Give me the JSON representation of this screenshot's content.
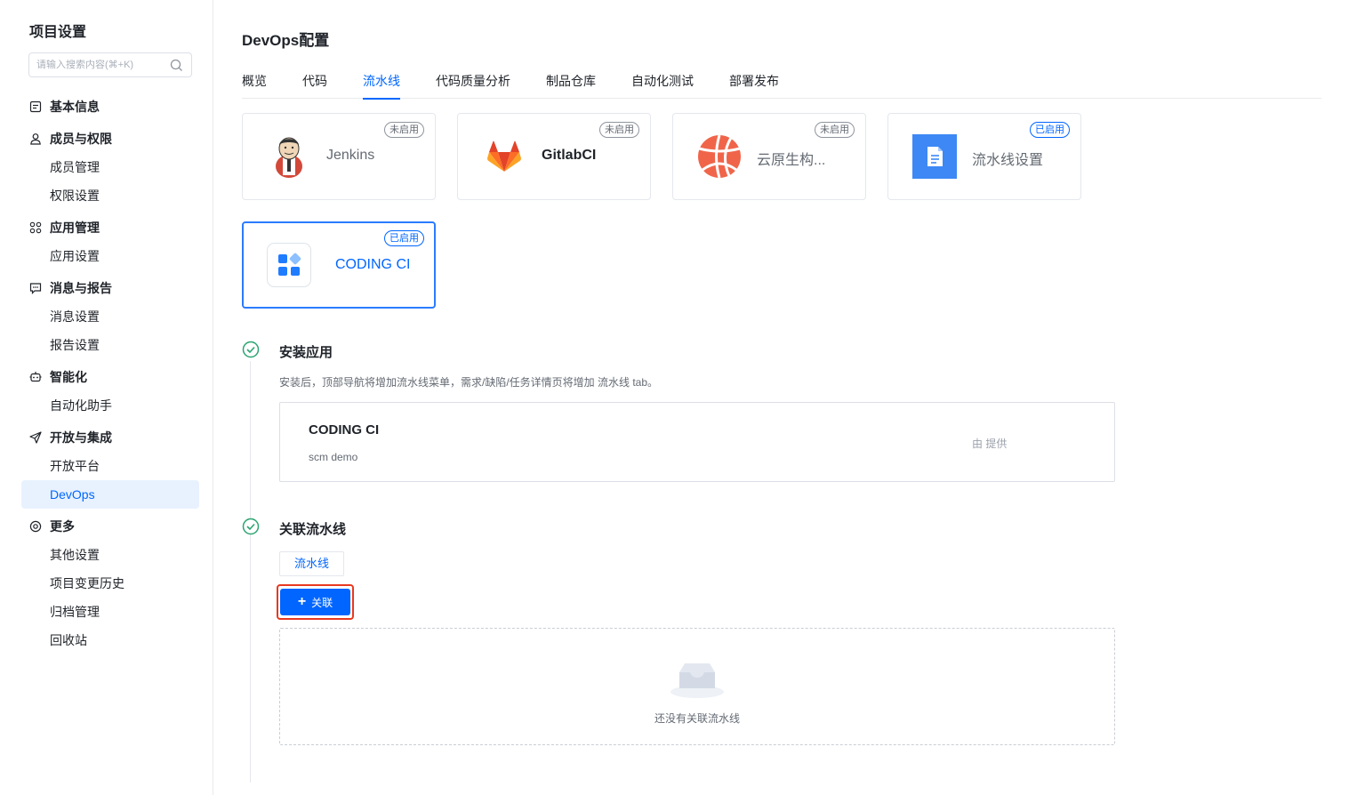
{
  "sidebar": {
    "title": "项目设置",
    "search_placeholder": "请输入搜索内容(⌘+K)",
    "groups": [
      {
        "label": "基本信息",
        "icon": "document-icon",
        "items": []
      },
      {
        "label": "成员与权限",
        "icon": "user-icon",
        "items": [
          "成员管理",
          "权限设置"
        ]
      },
      {
        "label": "应用管理",
        "icon": "apps-icon",
        "items": [
          "应用设置"
        ]
      },
      {
        "label": "消息与报告",
        "icon": "message-icon",
        "items": [
          "消息设置",
          "报告设置"
        ]
      },
      {
        "label": "智能化",
        "icon": "robot-icon",
        "items": [
          "自动化助手"
        ]
      },
      {
        "label": "开放与集成",
        "icon": "send-icon",
        "items": [
          "开放平台",
          "DevOps"
        ]
      },
      {
        "label": "更多",
        "icon": "settings-icon",
        "items": [
          "其他设置",
          "项目变更历史",
          "归档管理",
          "回收站"
        ]
      }
    ],
    "active_item": "DevOps"
  },
  "page": {
    "title": "DevOps配置",
    "tabs": [
      "概览",
      "代码",
      "流水线",
      "代码质量分析",
      "制品仓库",
      "自动化测试",
      "部署发布"
    ],
    "active_tab": "流水线"
  },
  "cards": [
    {
      "name": "Jenkins",
      "status": "未启用",
      "logo": "jenkins-logo"
    },
    {
      "name": "GitlabCI",
      "status": "未启用",
      "logo": "gitlab-logo"
    },
    {
      "name": "云原生构...",
      "status": "未启用",
      "logo": "cloud-native-logo"
    },
    {
      "name": "流水线设置",
      "status": "已启用",
      "logo": "pipeline-doc-logo"
    },
    {
      "name": "CODING CI",
      "status": "已启用",
      "logo": "coding-ci-logo"
    }
  ],
  "install": {
    "title": "安装应用",
    "desc": "安装后，顶部导航将增加流水线菜单，需求/缺陷/任务详情页将增加 流水线 tab。",
    "app_name": "CODING CI",
    "app_sub": "scm demo",
    "provider": "由 提供"
  },
  "link": {
    "title": "关联流水线",
    "chip": "流水线",
    "button": "关联",
    "empty": "还没有关联流水线"
  },
  "colors": {
    "primary": "#0066ff",
    "success": "#2ba471",
    "highlight": "#e8391f"
  }
}
